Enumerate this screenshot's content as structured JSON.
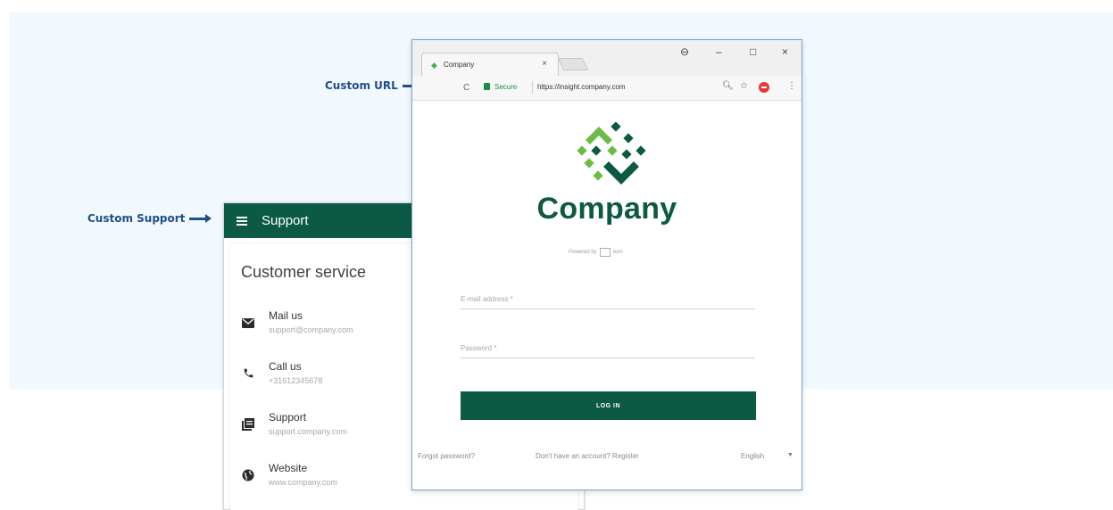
{
  "callouts": {
    "url_label": "Custom URL",
    "support_label": "Custom Support"
  },
  "support_panel": {
    "bar_title": "Support",
    "heading": "Customer service",
    "items": [
      {
        "label": "Mail us",
        "detail": "support@company.com",
        "icon": "mail-icon"
      },
      {
        "label": "Call us",
        "detail": "+31612345678",
        "icon": "phone-icon"
      },
      {
        "label": "Support",
        "detail": "support.company.com",
        "icon": "book-icon"
      },
      {
        "label": "Website",
        "detail": "www.company.com",
        "icon": "globe-icon"
      }
    ]
  },
  "browser": {
    "tab_title": "Company",
    "secure_label": "Secure",
    "url": "https://insight.company.com"
  },
  "login": {
    "company_name": "Company",
    "powered_by": "Powered by",
    "powered_brand": "ixon",
    "email_placeholder": "E-mail address *",
    "password_placeholder": "Password *",
    "login_button": "LOG IN",
    "forgot_password": "Forgot password?",
    "register": "Don't have an account? Register",
    "language": "English"
  },
  "colors": {
    "brand_green": "#0d5a44",
    "logo_light_green": "#6dbb46",
    "callout_blue": "#1f4f8a",
    "background_band": "#f1f8fe"
  }
}
